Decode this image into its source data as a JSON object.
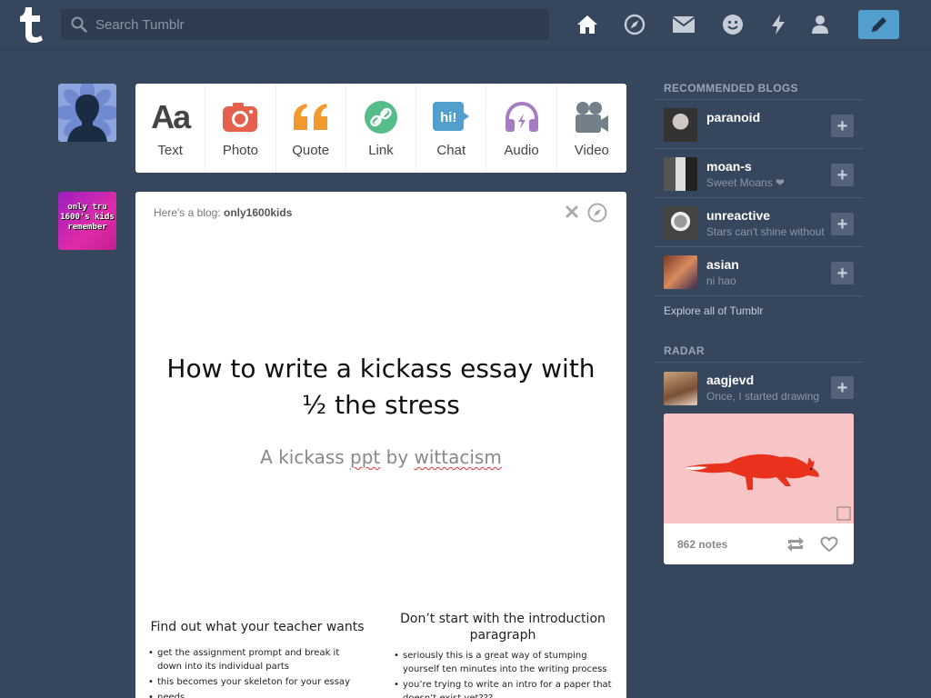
{
  "header": {
    "logo_letter": "t",
    "search_placeholder": "Search Tumblr",
    "nav_icons": [
      "home-icon",
      "explore-compass-icon",
      "inbox-mail-icon",
      "messaging-smiley-icon",
      "activity-lightning-icon",
      "account-person-icon"
    ],
    "compose_icon": "pencil-icon"
  },
  "post_bar": {
    "items": [
      {
        "label": "Text",
        "icon": "text-aa-icon",
        "color": "#444444",
        "glyph": "Aa"
      },
      {
        "label": "Photo",
        "icon": "camera-icon",
        "color": "#e4604d"
      },
      {
        "label": "Quote",
        "icon": "quote-icon",
        "color": "#f2992e"
      },
      {
        "label": "Link",
        "icon": "link-icon",
        "color": "#56bc8a"
      },
      {
        "label": "Chat",
        "icon": "chat-bubble-icon",
        "color": "#529ecc",
        "glyph": "hi!"
      },
      {
        "label": "Audio",
        "icon": "headphones-icon",
        "color": "#a77dc2"
      },
      {
        "label": "Video",
        "icon": "video-camera-icon",
        "color": "#748089"
      }
    ]
  },
  "post": {
    "avatar_text": "only tru 1600's kids remember",
    "heading_prefix": "Here's a blog:",
    "blog_name": "only1600kids",
    "slide": {
      "title_line1": "How to write a kickass essay with",
      "title_line2": "½ the stress",
      "subtitle_a": "A kickass",
      "subtitle_b": "ppt",
      "subtitle_c": "by",
      "subtitle_d": "wittacism",
      "left_col": {
        "heading": "Find out what your teacher wants",
        "bullets": [
          "get the assignment prompt and break it down into its individual parts",
          "this becomes your skeleton for your essay",
          "needs"
        ]
      },
      "right_col": {
        "heading": "Don’t start with the introduction paragraph",
        "bullets": [
          "seriously this is a great way of stumping yourself ten minutes into the writing process",
          "you’re trying to write an intro for a paper that doesn’t exist yet???"
        ]
      }
    }
  },
  "sidebar": {
    "recommended_title": "RECOMMENDED BLOGS",
    "blogs": [
      {
        "name": "paranoid",
        "desc": ""
      },
      {
        "name": "moan-s",
        "desc": "Sweet Moans ❤"
      },
      {
        "name": "unreactive",
        "desc": "Stars can't shine without"
      },
      {
        "name": "asian",
        "desc": "ni hao"
      }
    ],
    "explore_link": "Explore all of Tumblr",
    "radar_title": "RADAR",
    "radar": {
      "name": "aagjevd",
      "desc": "Once, I started drawing",
      "notes": "862 notes"
    }
  }
}
